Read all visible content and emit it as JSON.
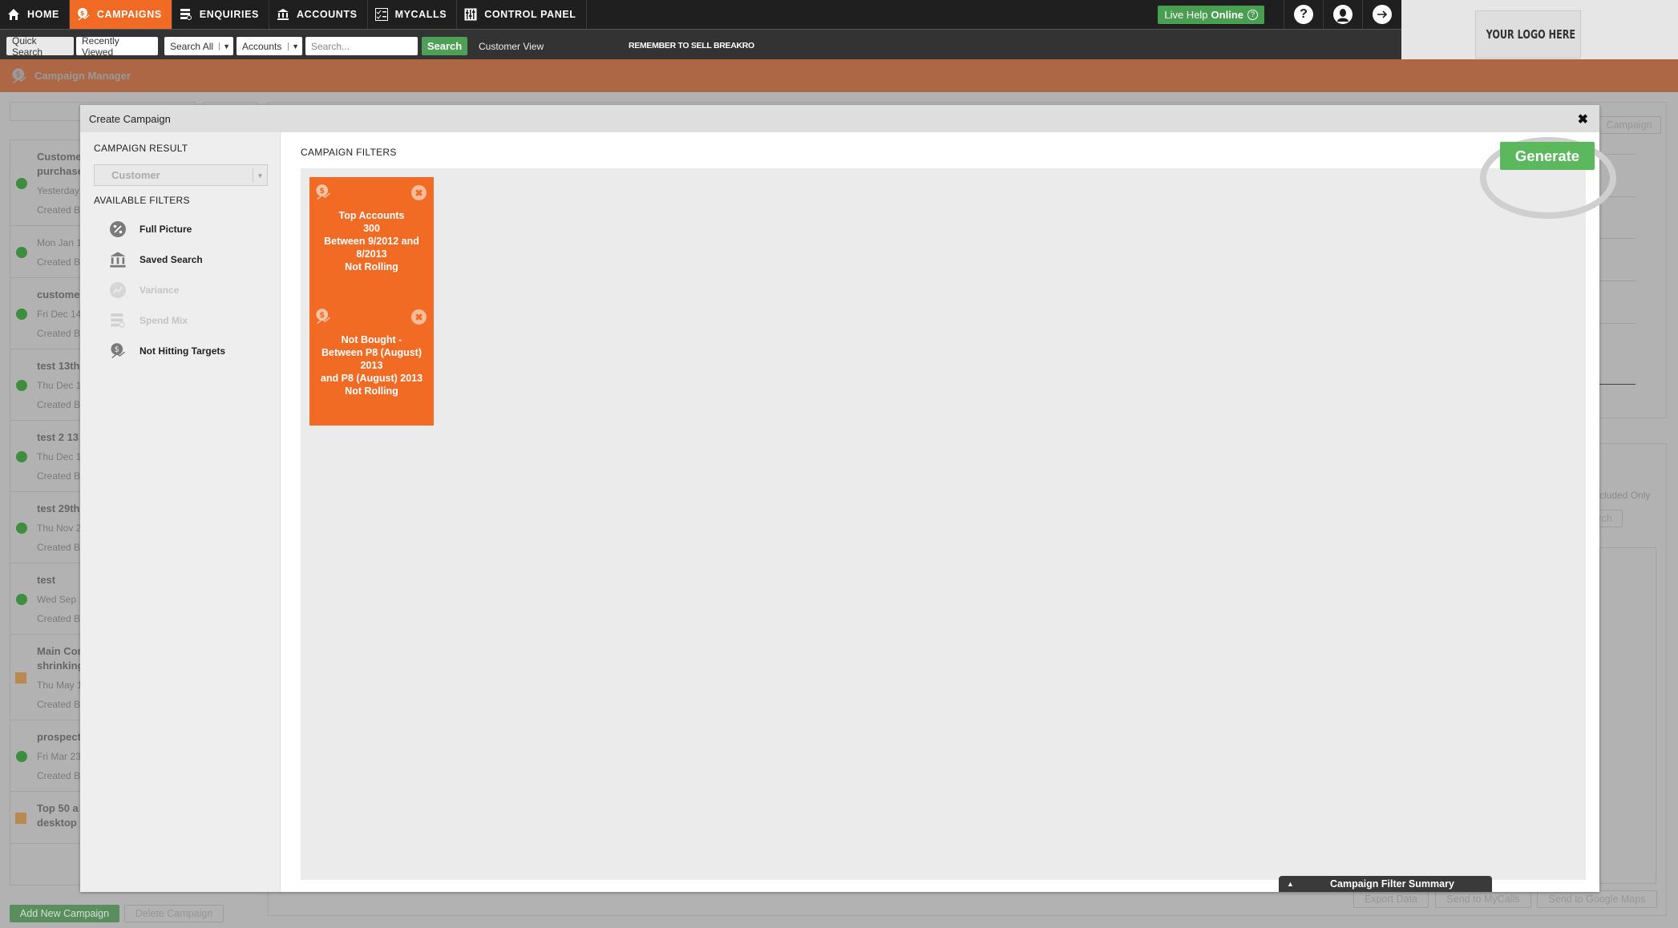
{
  "nav": {
    "items": [
      {
        "label": "HOME",
        "icon": "home-icon",
        "active": false
      },
      {
        "label": "CAMPAIGNS",
        "icon": "campaign-icon",
        "active": true
      },
      {
        "label": "ENQUIRIES",
        "icon": "enquiries-icon",
        "active": false
      },
      {
        "label": "ACCOUNTS",
        "icon": "bank-icon",
        "active": false
      },
      {
        "label": "MYCALLS",
        "icon": "checklist-icon",
        "active": false
      },
      {
        "label": "CONTROL PANEL",
        "icon": "sliders-icon",
        "active": false
      }
    ],
    "live_help_prefix": "Live Help",
    "live_help_status": "Online",
    "help_glyph": "?",
    "logo_text": "YOUR LOGO HERE"
  },
  "searchbar": {
    "quick_search": "Quick Search",
    "recently_viewed": "Recently Viewed",
    "scope_select": "Search All",
    "type_select": "Accounts",
    "search_placeholder": "Search...",
    "search_button": "Search",
    "customer_view": "Customer View",
    "ticker": "REMEMBER TO SELL BREAKRO"
  },
  "page": {
    "title": "Campaign Manager"
  },
  "background": {
    "campaigns": [
      {
        "name": [
          "Custome",
          "purchase"
        ],
        "date": "Yesterday",
        "by": "Created B",
        "status": "active"
      },
      {
        "name": [],
        "date": "Mon Jan 1",
        "by": "Created B",
        "status": "active"
      },
      {
        "name": [
          "custome"
        ],
        "date": "Fri Dec 14",
        "by": "Created B",
        "status": "active"
      },
      {
        "name": [
          "test 13th"
        ],
        "date": "Thu Dec 1",
        "by": "Created B",
        "status": "active"
      },
      {
        "name": [
          "test 2 13"
        ],
        "date": "Thu Dec 1",
        "by": "Created B",
        "status": "active"
      },
      {
        "name": [
          "test 29th"
        ],
        "date": "Thu Nov 2",
        "by": "Created B",
        "status": "active"
      },
      {
        "name": [
          "test"
        ],
        "date": "Wed Sep 1",
        "by": "Created B",
        "status": "active"
      },
      {
        "name": [
          "Main Cor",
          "shrinking"
        ],
        "date": "Thu May 1",
        "by": "Created B",
        "status": "pending"
      },
      {
        "name": [
          "prospect"
        ],
        "date": "Fri Mar 23",
        "by": "Created B",
        "status": "active"
      },
      {
        "name": [
          "Top 50 a",
          "desktop"
        ],
        "date": "",
        "by": "",
        "status": "pending"
      }
    ],
    "add_campaign": "Add New Campaign",
    "delete_campaign": "Delete Campaign",
    "top_right_button": "Campaign",
    "included_only": "cluded Only",
    "search_fragment": "rch",
    "export_data": "Export Data",
    "send_mycalls": "Send to MyCalls",
    "send_maps": "Send to Google Maps"
  },
  "modal": {
    "title": "Create Campaign",
    "close_glyph": "✖",
    "campaign_result_label": "CAMPAIGN RESULT",
    "campaign_result_value": "Customer",
    "available_filters_label": "AVAILABLE FILTERS",
    "available_filters": [
      {
        "label": "Full Picture",
        "icon": "percent-icon",
        "enabled": true
      },
      {
        "label": "Saved Search",
        "icon": "bank-icon",
        "enabled": true
      },
      {
        "label": "Variance",
        "icon": "chart-icon",
        "enabled": false
      },
      {
        "label": "Spend Mix",
        "icon": "list-search-icon",
        "enabled": false
      },
      {
        "label": "Not Hitting Targets",
        "icon": "campaign-icon",
        "enabled": true
      }
    ],
    "campaign_filters_label": "CAMPAIGN FILTERS",
    "filter_cards": [
      {
        "lines": [
          "Top Accounts",
          "300",
          "Between 9/2012 and",
          "8/2013",
          "Not Rolling"
        ]
      },
      {
        "lines": [
          "Not Bought -",
          "Between P8 (August) 2013",
          "and P8 (August) 2013",
          "Not Rolling"
        ]
      }
    ],
    "generate_label": "Generate",
    "summary_tab_label": "Campaign Filter Summary",
    "colors": {
      "card": "#f26b24",
      "generate": "#5cb85c"
    }
  }
}
